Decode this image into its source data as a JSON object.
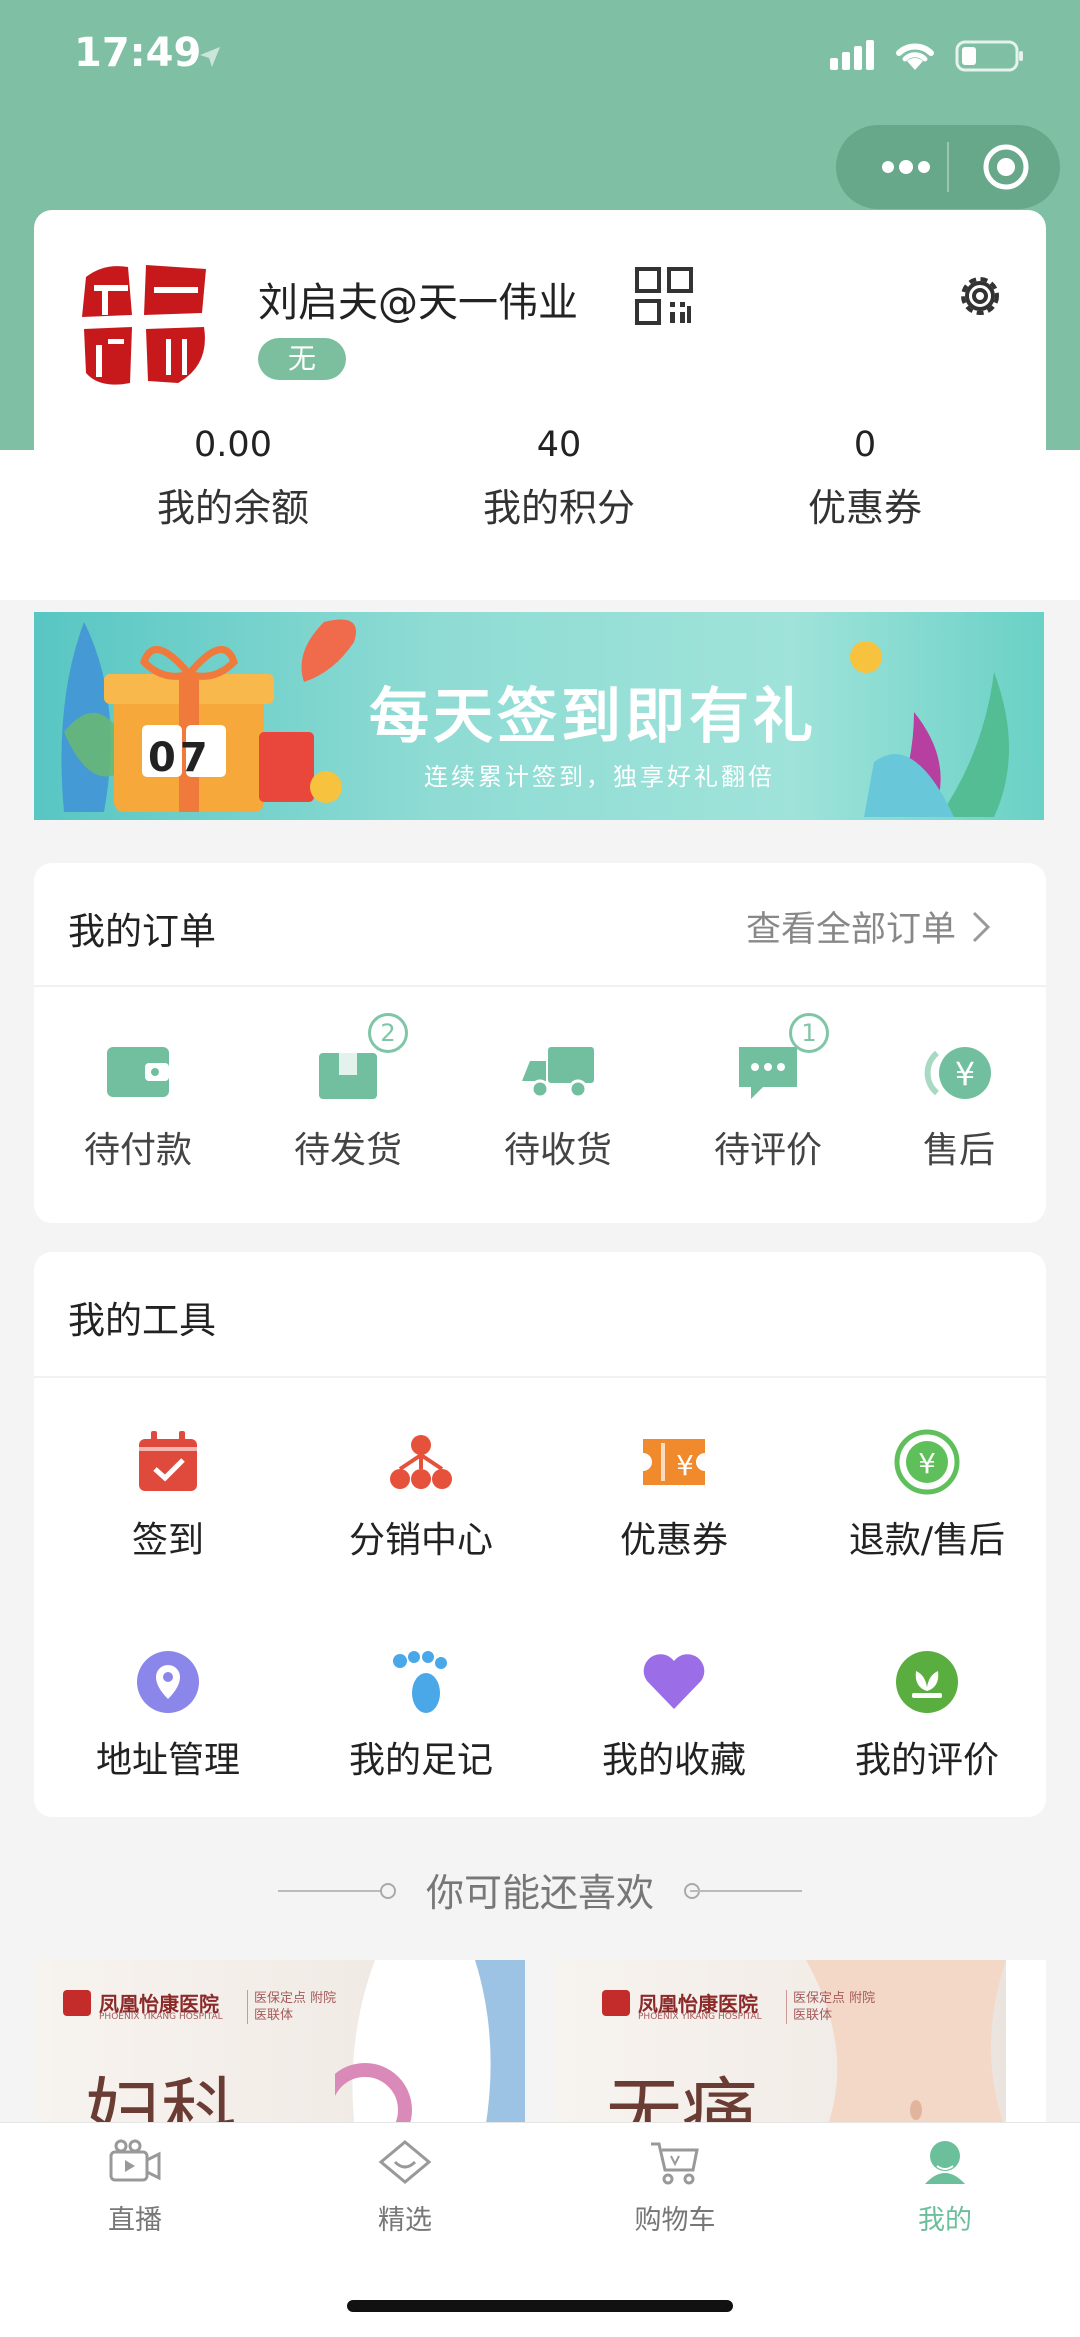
{
  "status_bar": {
    "time": "17:49"
  },
  "profile": {
    "name": "刘启夫@天一伟业",
    "level_badge": "无",
    "stats": [
      {
        "value": "0.00",
        "label": "我的余额"
      },
      {
        "value": "40",
        "label": "我的积分"
      },
      {
        "value": "0",
        "label": "优惠券"
      }
    ]
  },
  "banner": {
    "title": "每天签到即有礼",
    "subtitle": "连续累计签到，独享好礼翻倍",
    "calendar_text": "07"
  },
  "orders": {
    "title": "我的订单",
    "view_all": "查看全部订单",
    "items": [
      {
        "label": "待付款",
        "icon": "wallet-icon"
      },
      {
        "label": "待发货",
        "icon": "package-icon",
        "badge": "2"
      },
      {
        "label": "待收货",
        "icon": "truck-icon"
      },
      {
        "label": "待评价",
        "icon": "comment-icon",
        "badge": "1"
      },
      {
        "label": "售后",
        "icon": "after-sale-icon"
      }
    ]
  },
  "tools": {
    "title": "我的工具",
    "items": [
      {
        "label": "签到",
        "icon": "calendar-check-icon"
      },
      {
        "label": "分销中心",
        "icon": "distribution-icon"
      },
      {
        "label": "优惠券",
        "icon": "coupon-icon"
      },
      {
        "label": "退款/售后",
        "icon": "refund-icon"
      },
      {
        "label": "地址管理",
        "icon": "location-icon"
      },
      {
        "label": "我的足记",
        "icon": "footprint-icon"
      },
      {
        "label": "我的收藏",
        "icon": "heart-icon"
      },
      {
        "label": "我的评价",
        "icon": "review-icon"
      }
    ]
  },
  "recommend": {
    "title": "你可能还喜欢"
  },
  "products": [
    {
      "hospital": "凤凰怡康医院",
      "hospital_en": "PHOENIX YIKANG HOSPITAL",
      "tag": "医保定点 附院医联体",
      "headline": "妇科"
    },
    {
      "hospital": "凤凰怡康医院",
      "hospital_en": "PHOENIX YIKANG HOSPITAL",
      "tag": "医保定点 附院医联体",
      "headline": "无痛"
    }
  ],
  "tabbar": [
    {
      "label": "直播",
      "icon": "live-icon"
    },
    {
      "label": "精选",
      "icon": "featured-icon"
    },
    {
      "label": "购物车",
      "icon": "cart-icon"
    },
    {
      "label": "我的",
      "icon": "user-icon",
      "active": true
    }
  ],
  "colors": {
    "brand": "#7fbfa3",
    "accent": "#6cbf9b",
    "red": "#e04a3c"
  }
}
